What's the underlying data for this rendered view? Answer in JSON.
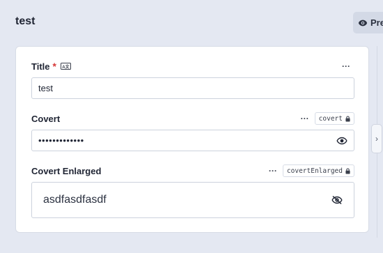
{
  "page": {
    "title": "test",
    "preview_label": "Pre"
  },
  "fields": {
    "title": {
      "label": "Title",
      "required_mark": "*",
      "more": "···",
      "value": "test"
    },
    "covert": {
      "label": "Covert",
      "more": "···",
      "key": "covert",
      "value_masked": "•••••••••••••"
    },
    "covert_enlarged": {
      "label": "Covert Enlarged",
      "more": "···",
      "key": "covertEnlarged",
      "value": "asdfasdfasdf"
    }
  },
  "icons": {
    "preview": "eye-icon",
    "i18n": "translate-icon",
    "lock": "lock-icon",
    "show_password": "eye-icon",
    "hide_password": "eye-off-icon",
    "expand": "chevron-right-icon"
  },
  "colors": {
    "background": "#e4e8f2",
    "card": "#ffffff",
    "required": "#d63a3a"
  }
}
